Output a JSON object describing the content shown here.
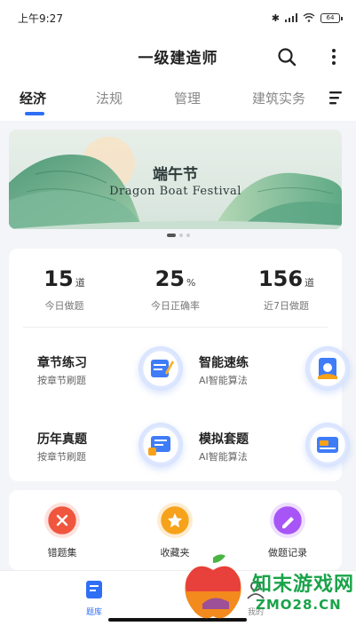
{
  "status_bar": {
    "time": "上午9:27",
    "battery": "64"
  },
  "header": {
    "title": "一级建造师"
  },
  "tabs": [
    {
      "label": "经济",
      "active": true
    },
    {
      "label": "法规",
      "active": false
    },
    {
      "label": "管理",
      "active": false
    },
    {
      "label": "建筑实务",
      "active": false
    }
  ],
  "banner": {
    "title": "端午节",
    "subtitle": "Dragon Boat Festival"
  },
  "stats": [
    {
      "value": "15",
      "unit": "道",
      "label": "今日做题"
    },
    {
      "value": "25",
      "unit": "%",
      "label": "今日正确率"
    },
    {
      "value": "156",
      "unit": "道",
      "label": "近7日做题"
    }
  ],
  "features": [
    {
      "title": "章节练习",
      "subtitle": "按章节刷题",
      "icon": "chapter-practice-icon"
    },
    {
      "title": "智能速练",
      "subtitle": "AI智能算法",
      "icon": "smart-practice-icon"
    },
    {
      "title": "历年真题",
      "subtitle": "按章节刷题",
      "icon": "past-exams-icon"
    },
    {
      "title": "模拟套题",
      "subtitle": "AI智能算法",
      "icon": "mock-exam-icon"
    }
  ],
  "tools": [
    {
      "label": "错题集",
      "color": "#f0563e"
    },
    {
      "label": "收藏夹",
      "color": "#f7a21b"
    },
    {
      "label": "做题记录",
      "color": "#a855f7"
    }
  ],
  "bottom_nav": [
    {
      "label": "题库",
      "active": true
    },
    {
      "label": "我的",
      "active": false
    }
  ],
  "watermark": {
    "cn": "知末游戏网",
    "en": "ZMO28.CN"
  },
  "colors": {
    "accent": "#2f6ff6",
    "watermark": "#1aa34a"
  }
}
